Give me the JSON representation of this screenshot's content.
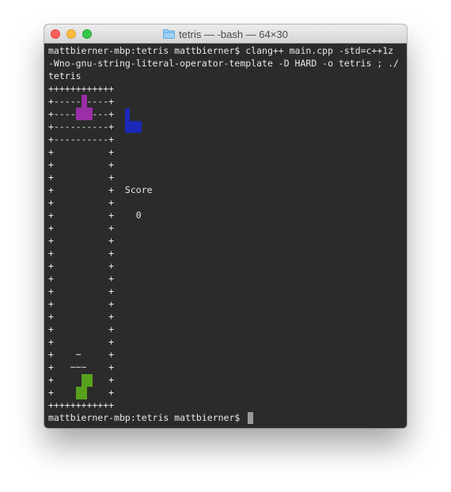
{
  "window": {
    "title": "tetris — -bash — 64×30",
    "folder_icon": "folder-icon",
    "buttons": [
      "close-button",
      "minimize-button",
      "zoom-button"
    ]
  },
  "terminal": {
    "lines": [
      "mattbierner-mbp:tetris mattbierner$ clang++ main.cpp -std=c++1z",
      "-Wno-gnu-string-literal-operator-template -D HARD -o tetris ; ./",
      "tetris",
      "++++++++++++",
      "+----------+",
      "+----------+",
      "+----------+",
      "+----------+",
      "+          +",
      "+          +",
      "+          +",
      "+          +  Score",
      "+          +",
      "+          +    0",
      "+          +",
      "+          +",
      "+          +",
      "+          +",
      "+          +",
      "+          +",
      "+          +",
      "+          +",
      "+          +",
      "+          +",
      "+    ~     +",
      "+   ~~~    +",
      "+          +",
      "+          +",
      "++++++++++++",
      "mattbierner-mbp:tetris mattbierner$ "
    ],
    "colors": {
      "background": "#2b2b2b",
      "text": "#e8e8e8",
      "current_piece": "#9a2fa8",
      "next_piece": "#1a28b8",
      "placed_piece": "#57a11c"
    }
  }
}
